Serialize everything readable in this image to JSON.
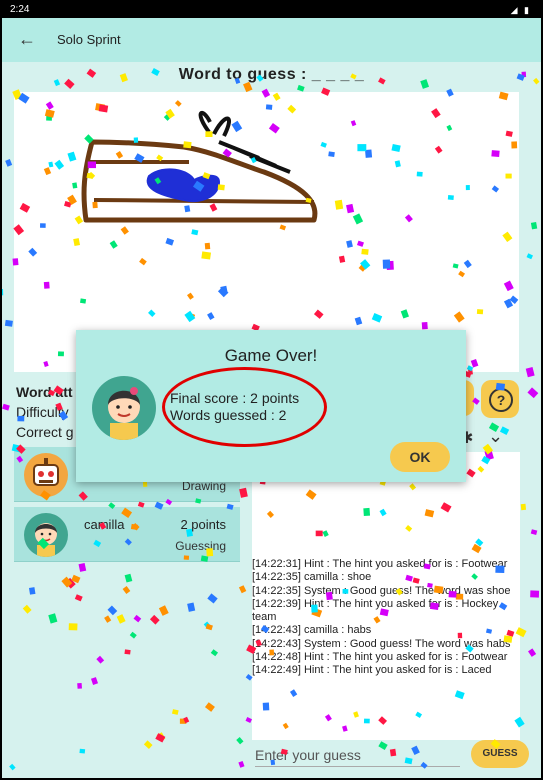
{
  "status_bar": {
    "time": "2:24",
    "system_icons": "signal-battery-icons"
  },
  "app_bar": {
    "title": "Solo Sprint",
    "back_icon": "arrow-left-icon"
  },
  "game": {
    "word_to_guess": "Word to guess : _ _ _ _"
  },
  "left_info": {
    "word_attempts": "Word att",
    "difficulty": "Difficulty",
    "correct": "Correct g"
  },
  "players": [
    {
      "name": "",
      "points": "",
      "role": "Drawing",
      "avatar": "robot-avatar-icon"
    },
    {
      "name": "camilla",
      "points": "2 points",
      "role": "Guessing",
      "avatar": "girl-avatar-icon"
    }
  ],
  "dialog": {
    "title": "Game Over!",
    "final_score": "Final score : 2 points",
    "words_guessed": "Words guessed : 2",
    "ok_label": "OK"
  },
  "chat": {
    "messages": [
      "[14:22:31] Hint : The hint you asked for is : Footwear",
      "[14:22:35] camilla : shoe",
      "[14:22:35] System : Good guess! The word was shoe",
      "[14:22:39] Hint : The hint you asked for is : Hockey team",
      "[14:22:43] camilla : habs",
      "[14:22:43] System : Good guess! The word was habs",
      "[14:22:48] Hint : The hint you asked for is : Footwear",
      "[14:22:49] Hint : The hint you asked for is : Laced"
    ],
    "input_placeholder": "Enter your guess",
    "guess_label": "GUESS"
  },
  "controls": {
    "help_label": "?",
    "help_icon": "question-icon",
    "tools_icon": "gear-icon",
    "collapse_icon": "chevron-down-icon"
  },
  "colors": {
    "teal_bar": "#b2ebe4",
    "panel_bg": "#d6f2ee",
    "accent_yellow": "#f6c94e",
    "highlight_red": "#e00000"
  }
}
